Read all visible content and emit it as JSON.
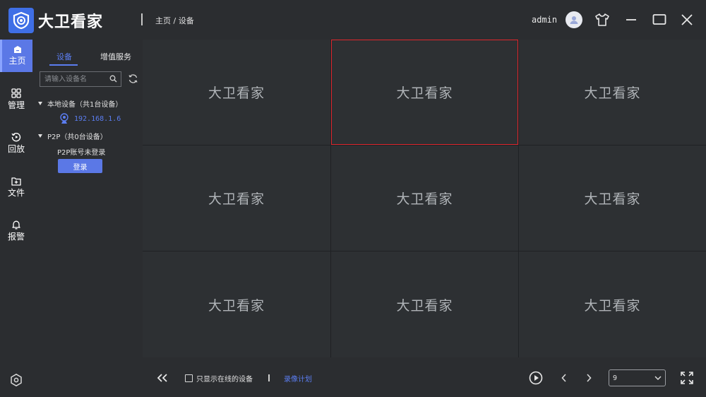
{
  "app": {
    "name": "大卫看家",
    "breadcrumb": "主页 / 设备"
  },
  "header": {
    "username": "admin",
    "icons": [
      "user-avatar-icon",
      "skin-shirt-icon",
      "minimize-icon",
      "maximize-icon",
      "close-icon"
    ]
  },
  "nav": {
    "items": [
      {
        "label": "主页",
        "icon": "home-icon",
        "active": true
      },
      {
        "label": "管理",
        "icon": "grid-icon",
        "active": false
      },
      {
        "label": "回放",
        "icon": "playback-icon",
        "active": false
      },
      {
        "label": "文件",
        "icon": "folder-icon",
        "active": false
      },
      {
        "label": "报警",
        "icon": "bell-icon",
        "active": false
      }
    ],
    "settings_icon": "settings-icon"
  },
  "panel": {
    "tabs": [
      "设备",
      "增值服务"
    ],
    "active_tab": "设备",
    "search": {
      "placeholder": "请输入设备名",
      "value": ""
    },
    "local_group": "本地设备（共1台设备）",
    "local_devices": [
      "192.168.1.6"
    ],
    "p2p_group": "P2P（共0台设备）",
    "p2p_note": "P2P账号未登录",
    "login_label": "登录"
  },
  "grid": {
    "layout": "3x3",
    "selected_index": 1,
    "cells": [
      "大卫看家",
      "大卫看家",
      "大卫看家",
      "大卫看家",
      "大卫看家",
      "大卫看家",
      "大卫看家",
      "大卫看家",
      "大卫看家"
    ]
  },
  "bottom": {
    "online_only_label": "只显示在线的设备",
    "online_only_checked": false,
    "record_plan_label": "录像计划",
    "split_count": "9"
  },
  "colors": {
    "accent": "#5b78e6",
    "link": "#5b7df0",
    "selected_border": "#e0262c",
    "background": "#2b2d30",
    "cell": "#2d3033"
  }
}
